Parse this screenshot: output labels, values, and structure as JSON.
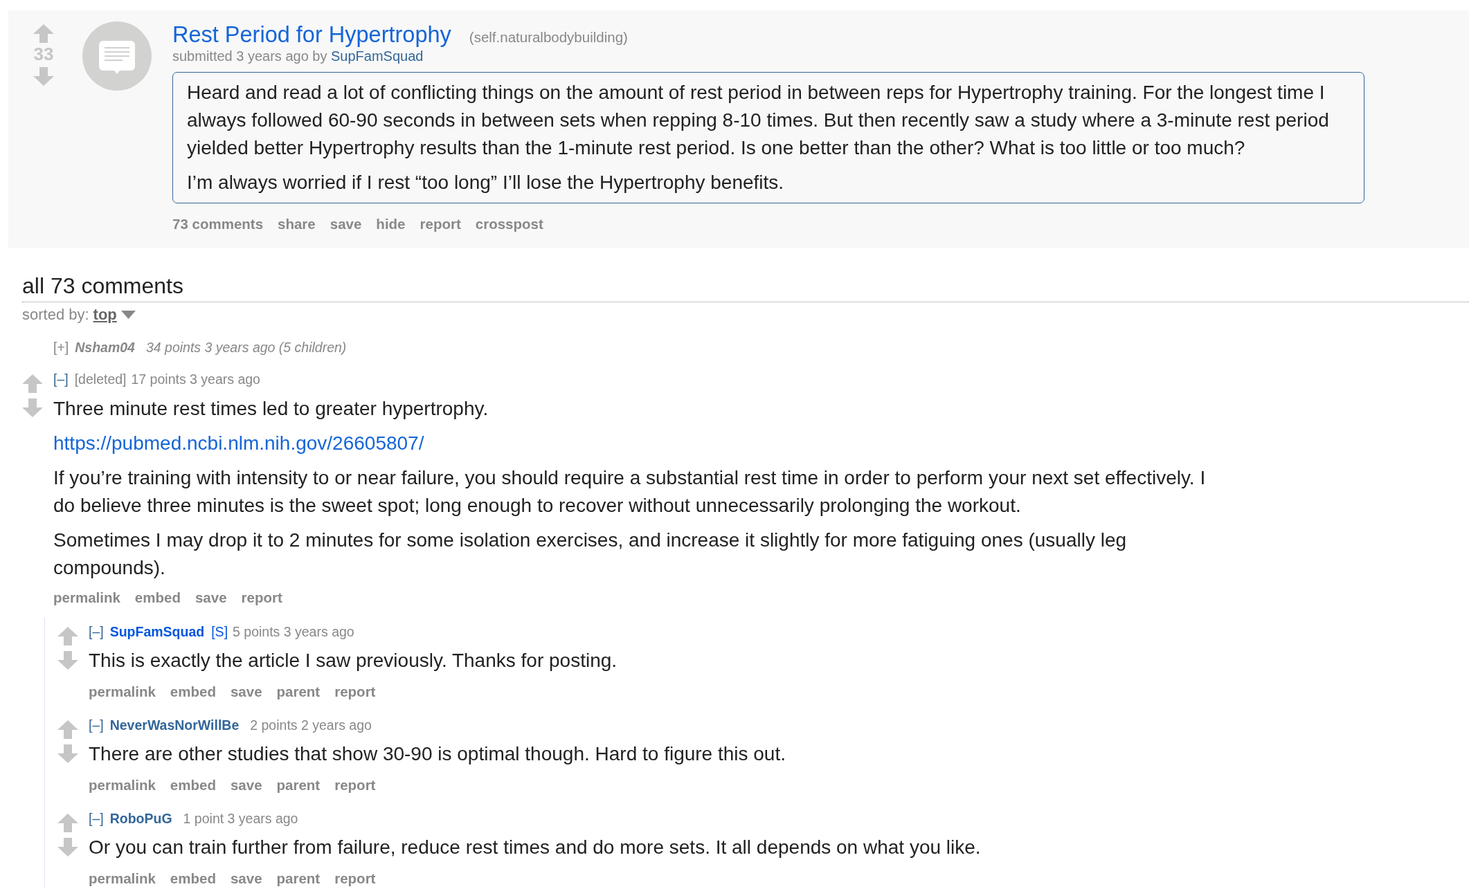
{
  "post": {
    "score": "33",
    "title": "Rest Period for Hypertrophy",
    "domain": "(self.naturalbodybuilding)",
    "submitted": "submitted 3 years ago by",
    "author": "SupFamSquad",
    "body": [
      "Heard and read a lot of conflicting things on the amount of rest period in between reps for Hypertrophy training. For the longest time I always followed 60-90 seconds in between sets when repping 8-10 times. But then recently saw a study where a 3-minute rest period yielded better Hypertrophy results than the 1-minute rest period. Is one better than the other? What is too little or too much?",
      "I’m always worried if I rest “too long” I’ll lose the Hypertrophy benefits."
    ],
    "actions": [
      "73 comments",
      "share",
      "save",
      "hide",
      "report",
      "crosspost"
    ]
  },
  "comments_header": {
    "title": "all 73 comments",
    "sort_label": "sorted by:",
    "sort_value": "top"
  },
  "comments": [
    {
      "kind": "user",
      "collapsed": true,
      "toggle": "[+]",
      "author": "Nsham04",
      "meta": "34 points 3 years ago (5 children)"
    },
    {
      "kind": "deleted",
      "collapsed": false,
      "toggle": "[–]",
      "author": "[deleted]",
      "meta": "17 points 3 years ago",
      "body": [
        {
          "kind": "text",
          "text": "Three minute rest times led to greater hypertrophy."
        },
        {
          "kind": "link",
          "text": "https://pubmed.ncbi.nlm.nih.gov/26605807/"
        },
        {
          "kind": "text",
          "text": "If you’re training with intensity to or near failure, you should require a substantial rest time in order to perform your next set effectively. I do believe three minutes is the sweet spot; long enough to recover without unnecessarily prolonging the workout."
        },
        {
          "kind": "text",
          "text": "Sometimes I may drop it to 2 minutes for some isolation exercises, and increase it slightly for more fatiguing ones (usually leg compounds)."
        }
      ],
      "actions": [
        "permalink",
        "embed",
        "save",
        "report"
      ],
      "children": [
        {
          "kind": "submitter",
          "collapsed": false,
          "toggle": "[–]",
          "author": "SupFamSquad",
          "author_tag": "[S]",
          "meta": "5 points 3 years ago",
          "body": [
            {
              "kind": "text",
              "text": "This is exactly the article I saw previously. Thanks for posting."
            }
          ],
          "actions": [
            "permalink",
            "embed",
            "save",
            "parent",
            "report"
          ]
        },
        {
          "kind": "user",
          "collapsed": false,
          "toggle": "[–]",
          "author": "NeverWasNorWillBe",
          "meta": "2 points 2 years ago",
          "body": [
            {
              "kind": "text",
              "text": "There are other studies that show 30-90 is optimal though. Hard to figure this out."
            }
          ],
          "actions": [
            "permalink",
            "embed",
            "save",
            "parent",
            "report"
          ]
        },
        {
          "kind": "user",
          "collapsed": false,
          "toggle": "[–]",
          "author": "RoboPuG",
          "meta": "1 point 3 years ago",
          "body": [
            {
              "kind": "text",
              "text": "Or you can train further from failure, reduce rest times and do more sets. It all depends on what you like."
            }
          ],
          "actions": [
            "permalink",
            "embed",
            "save",
            "parent",
            "report"
          ]
        }
      ]
    }
  ]
}
